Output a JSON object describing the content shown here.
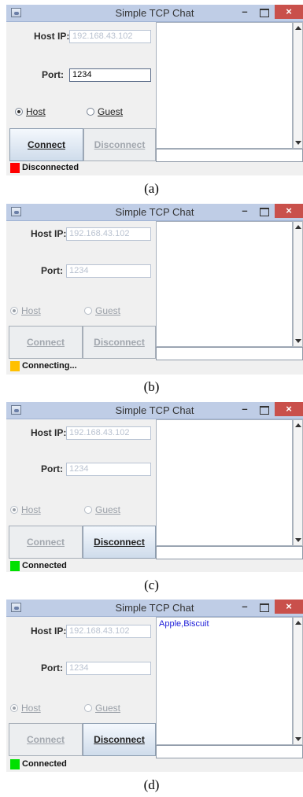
{
  "window": {
    "title": "Simple TCP Chat",
    "minimize_glyph": "–",
    "close_glyph": "×"
  },
  "labels": {
    "host_ip": "Host IP:",
    "port": "Port:"
  },
  "buttons": {
    "connect": "Connect",
    "disconnect": "Disconnect"
  },
  "radios": {
    "host": "Host",
    "guest": "Guest"
  },
  "panels": [
    {
      "caption": "(a)",
      "host_ip_value": "192.168.43.102",
      "port_value": "1234",
      "port_editable": true,
      "radios_enabled": true,
      "selected_radio": "host",
      "connect_enabled": true,
      "disconnect_enabled": false,
      "status_text": "Disconnected",
      "status_color": "#ff0000",
      "chat_text": ""
    },
    {
      "caption": "(b)",
      "host_ip_value": "192.168.43.102",
      "port_value": "1234",
      "port_editable": false,
      "radios_enabled": false,
      "selected_radio": "host",
      "connect_enabled": false,
      "disconnect_enabled": false,
      "status_text": "Connecting...",
      "status_color": "#ffc000",
      "chat_text": ""
    },
    {
      "caption": "(c)",
      "host_ip_value": "192.168.43.102",
      "port_value": "1234",
      "port_editable": false,
      "radios_enabled": false,
      "selected_radio": "host",
      "connect_enabled": false,
      "disconnect_enabled": true,
      "status_text": "Connected",
      "status_color": "#00e000",
      "chat_text": ""
    },
    {
      "caption": "(d)",
      "host_ip_value": "192.168.43.102",
      "port_value": "1234",
      "port_editable": false,
      "radios_enabled": false,
      "selected_radio": "host",
      "connect_enabled": false,
      "disconnect_enabled": true,
      "status_text": "Connected",
      "status_color": "#00e000",
      "chat_text": "Apple,Biscuit"
    }
  ]
}
